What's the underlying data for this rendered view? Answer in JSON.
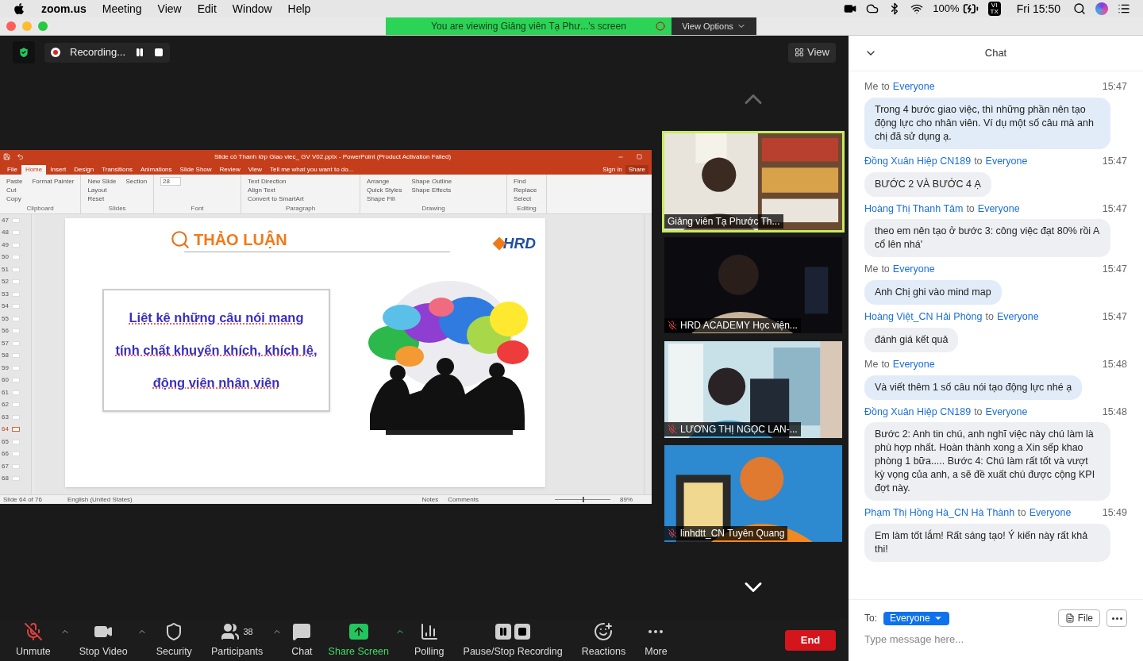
{
  "menu_bar": {
    "app_menus": [
      "zoom.us",
      "Meeting",
      "View",
      "Edit",
      "Window",
      "Help"
    ],
    "input_source": [
      "VI",
      "TX"
    ],
    "battery": "100%",
    "clock": "Fri 15:50"
  },
  "window": {
    "banner": "You are viewing Giảng viên Tạ Phư...'s screen",
    "view_options": "View Options"
  },
  "top_bar": {
    "recording": "Recording...",
    "view_button": "View"
  },
  "powerpoint": {
    "title": "Slide cô Thanh lớp Giao viec_ GV V02.pptx - PowerPoint (Product Activation Failed)",
    "tabs": [
      {
        "label": "File",
        "selected": false
      },
      {
        "label": "Home",
        "selected": true
      },
      {
        "label": "Insert",
        "selected": false
      },
      {
        "label": "Design",
        "selected": false
      },
      {
        "label": "Transitions",
        "selected": false
      },
      {
        "label": "Animations",
        "selected": false
      },
      {
        "label": "Slide Show",
        "selected": false
      },
      {
        "label": "Review",
        "selected": false
      },
      {
        "label": "View",
        "selected": false
      }
    ],
    "tell_me": "Tell me what you want to do...",
    "sign_in": "Sign in",
    "share": "Share",
    "groups": [
      {
        "label": "Clipboard",
        "commands": [
          "Paste",
          "Cut",
          "Copy",
          "Format Painter"
        ]
      },
      {
        "label": "Slides",
        "commands": [
          "New Slide",
          "Layout",
          "Reset",
          "Section"
        ]
      },
      {
        "label": "Font",
        "commands": [
          "28"
        ]
      },
      {
        "label": "Paragraph",
        "commands": [
          "Text Direction",
          "Align Text",
          "Convert to SmartArt"
        ]
      },
      {
        "label": "Drawing",
        "commands": [
          "Arrange",
          "Quick Styles",
          "Shape Fill",
          "Shape Outline",
          "Shape Effects"
        ]
      },
      {
        "label": "Editing",
        "commands": [
          "Find",
          "Replace",
          "Select"
        ]
      }
    ],
    "slide_numbers": [
      {
        "label": "47",
        "selected": false
      },
      {
        "label": "48",
        "selected": false
      },
      {
        "label": "49",
        "selected": false
      },
      {
        "label": "50",
        "selected": false
      },
      {
        "label": "51",
        "selected": false
      },
      {
        "label": "52",
        "selected": false
      },
      {
        "label": "53",
        "selected": false
      },
      {
        "label": "54",
        "selected": false
      },
      {
        "label": "55",
        "selected": false
      },
      {
        "label": "56",
        "selected": false
      },
      {
        "label": "57",
        "selected": false
      },
      {
        "label": "58",
        "selected": false
      },
      {
        "label": "59",
        "selected": false
      },
      {
        "label": "60",
        "selected": false
      },
      {
        "label": "61",
        "selected": false
      },
      {
        "label": "62",
        "selected": false
      },
      {
        "label": "63",
        "selected": false
      },
      {
        "label": "64",
        "selected": true
      },
      {
        "label": "65",
        "selected": false
      },
      {
        "label": "66",
        "selected": false
      },
      {
        "label": "67",
        "selected": false
      },
      {
        "label": "68",
        "selected": false
      }
    ],
    "slide": {
      "heading": "THẢO LUẬN",
      "logo": "HRD",
      "lines": [
        "Liệt kê những câu nói mang",
        "tính chất khuyến khích, khích lệ,",
        "động viên nhân viên"
      ]
    },
    "status": {
      "slide_info": "Slide 64 of 76",
      "language": "English (United States)",
      "notes": "Notes",
      "comments": "Comments",
      "zoom": "89%",
      "zoom_slider": {
        "level": 0.5
      }
    }
  },
  "videos": [
    {
      "name": "Giảng viên Tạ Phước Th...",
      "active_speaker": true,
      "muted": false
    },
    {
      "name": "HRD ACADEMY Học viện...",
      "active_speaker": false,
      "muted": true
    },
    {
      "name": "LƯƠNG THỊ NGỌC LAN-...",
      "active_speaker": false,
      "muted": true
    },
    {
      "name": "linhdtt_CN Tuyên Quang",
      "active_speaker": false,
      "muted": true
    }
  ],
  "toolbar": [
    {
      "kind": "mic",
      "label": "Unmute",
      "muted": true
    },
    {
      "kind": "video",
      "label": "Stop Video"
    },
    {
      "kind": "security",
      "label": "Security"
    },
    {
      "kind": "participants",
      "label": "Participants",
      "count": "38"
    },
    {
      "kind": "chat",
      "label": "Chat"
    },
    {
      "kind": "share",
      "label": "Share Screen"
    },
    {
      "kind": "polling",
      "label": "Polling"
    },
    {
      "kind": "recording",
      "label": "Pause/Stop Recording"
    },
    {
      "kind": "reactions",
      "label": "Reactions"
    },
    {
      "kind": "more",
      "label": "More"
    }
  ],
  "end_button": "End",
  "chat": {
    "title": "Chat",
    "messages": [
      {
        "sender": "Me",
        "to": "to",
        "recipient": "Everyone",
        "time": "15:47",
        "from_me": true,
        "text": "Trong 4 bước giao việc, thì những phần nên tạo động lực cho nhân viên. Ví dụ một số câu mà anh chị đã sử dụng ạ."
      },
      {
        "sender": "Đồng Xuân Hiệp CN189",
        "to": "to",
        "recipient": "Everyone",
        "time": "15:47",
        "from_me": false,
        "text": "BƯỚC 2 VÀ BƯỚC 4 Ạ"
      },
      {
        "sender": "Hoàng Thị Thanh Tâm",
        "to": "to",
        "recipient": "Everyone",
        "time": "15:47",
        "from_me": false,
        "text": "theo em nên tạo ở bước 3: công việc đạt 80% rồi A cổ lên nhá'"
      },
      {
        "sender": "Me",
        "to": "to",
        "recipient": "Everyone",
        "time": "15:47",
        "from_me": true,
        "text": "Anh Chị ghi vào mind map"
      },
      {
        "sender": "Hoàng Việt_CN Hải Phòng",
        "to": "to",
        "recipient": "Everyone",
        "time": "15:47",
        "from_me": false,
        "text": "đánh giá kết quả"
      },
      {
        "sender": "Me",
        "to": "to",
        "recipient": "Everyone",
        "time": "15:48",
        "from_me": true,
        "text": "Và viết thêm 1 số câu nói tạo động lực nhé ạ"
      },
      {
        "sender": "Đồng Xuân Hiệp CN189",
        "to": "to",
        "recipient": "Everyone",
        "time": "15:48",
        "from_me": false,
        "text": "Bước 2: Anh tin chú, anh nghĩ việc này chú làm là phù hợp nhất. Hoàn thành xong a Xin sếp khao phòng 1 bữa..... Bước 4: Chú làm rất tốt và vượt kỳ vọng của anh, a sẽ đề xuất chú được cộng KPI đợt này."
      },
      {
        "sender": "Phạm Thị Hồng Hà_CN Hà Thành",
        "to": "to",
        "recipient": "Everyone",
        "time": "15:49",
        "from_me": false,
        "text": "Em làm tốt lắm! Rất sáng tạo! Ý kiến này rất khả thi!"
      }
    ],
    "to_label": "To:",
    "recipient": "Everyone",
    "file_button": "File",
    "placeholder": "Type message here..."
  }
}
